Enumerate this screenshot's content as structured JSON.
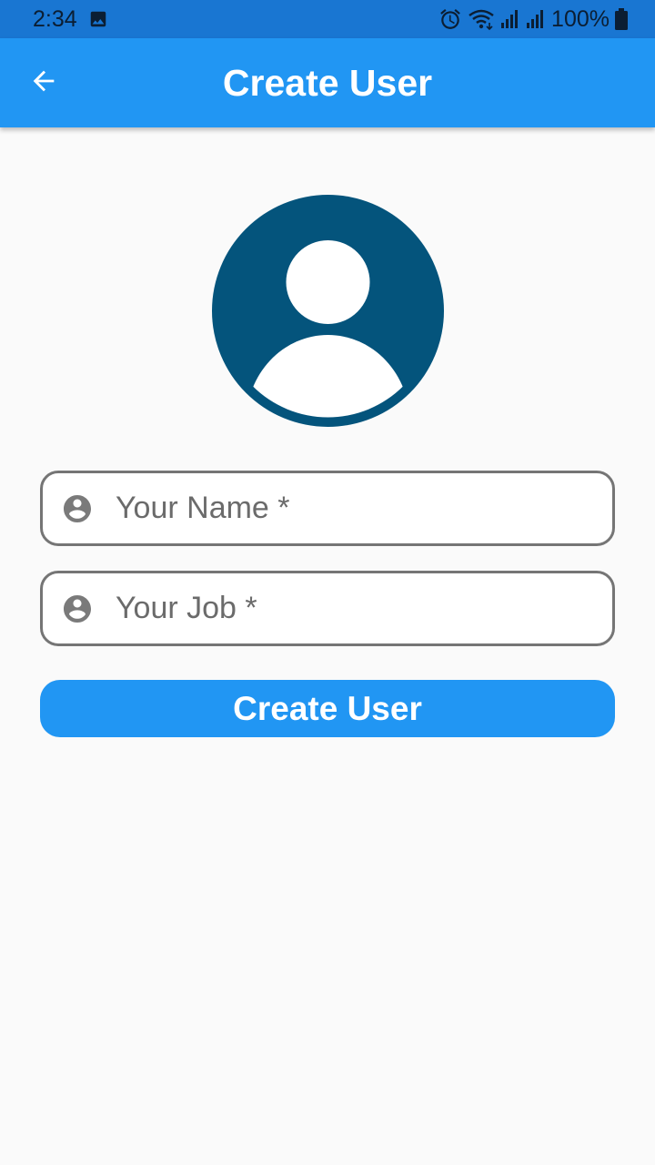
{
  "status_bar": {
    "time": "2:34",
    "battery": "100%",
    "icons": [
      "image-icon",
      "alarm-icon",
      "wifi-icon",
      "signal-icon",
      "signal-icon",
      "battery-icon"
    ]
  },
  "app_bar": {
    "title": "Create User",
    "back_icon": "arrow-back-icon",
    "color": "#2196f3"
  },
  "avatar": {
    "icon": "account-circle-icon",
    "color": "#04547c"
  },
  "form": {
    "name": {
      "placeholder": "Your Name *",
      "value": "",
      "icon": "account-circle-icon"
    },
    "job": {
      "placeholder": "Your Job *",
      "value": "",
      "icon": "account-circle-icon"
    },
    "submit_label": "Create User"
  },
  "colors": {
    "primary": "#2196f3",
    "status_bar": "#1976d2",
    "border": "#757575"
  }
}
